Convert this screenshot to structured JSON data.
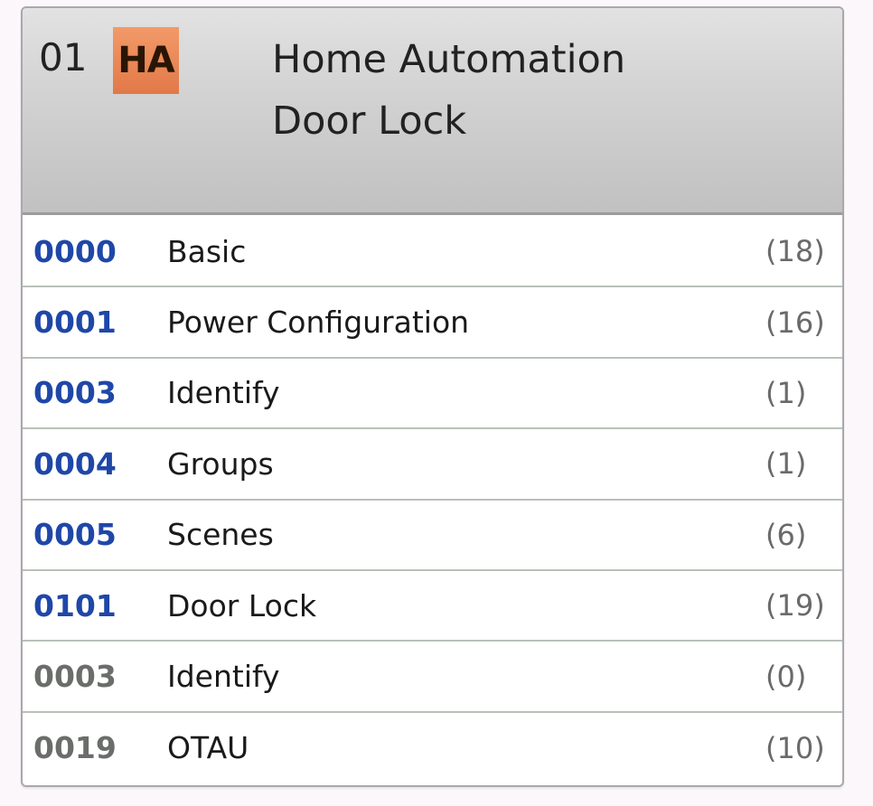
{
  "endpoint": {
    "id": "01",
    "profile_badge": "HA",
    "profile_name": "Home Automation",
    "device_name": "Door Lock"
  },
  "clusters": [
    {
      "id": "0000",
      "name": "Basic",
      "count": "(18)",
      "type": "server"
    },
    {
      "id": "0001",
      "name": "Power Configuration",
      "count": "(16)",
      "type": "server"
    },
    {
      "id": "0003",
      "name": "Identify",
      "count": "(1)",
      "type": "server"
    },
    {
      "id": "0004",
      "name": "Groups",
      "count": "(1)",
      "type": "server"
    },
    {
      "id": "0005",
      "name": "Scenes",
      "count": "(6)",
      "type": "server"
    },
    {
      "id": "0101",
      "name": "Door Lock",
      "count": "(19)",
      "type": "server"
    },
    {
      "id": "0003",
      "name": "Identify",
      "count": "(0)",
      "type": "client"
    },
    {
      "id": "0019",
      "name": "OTAU",
      "count": "(10)",
      "type": "client"
    }
  ],
  "colors": {
    "server_cluster_id": "#1f47a8",
    "client_cluster_id": "#6a6d6a",
    "badge": "#e8864f"
  }
}
